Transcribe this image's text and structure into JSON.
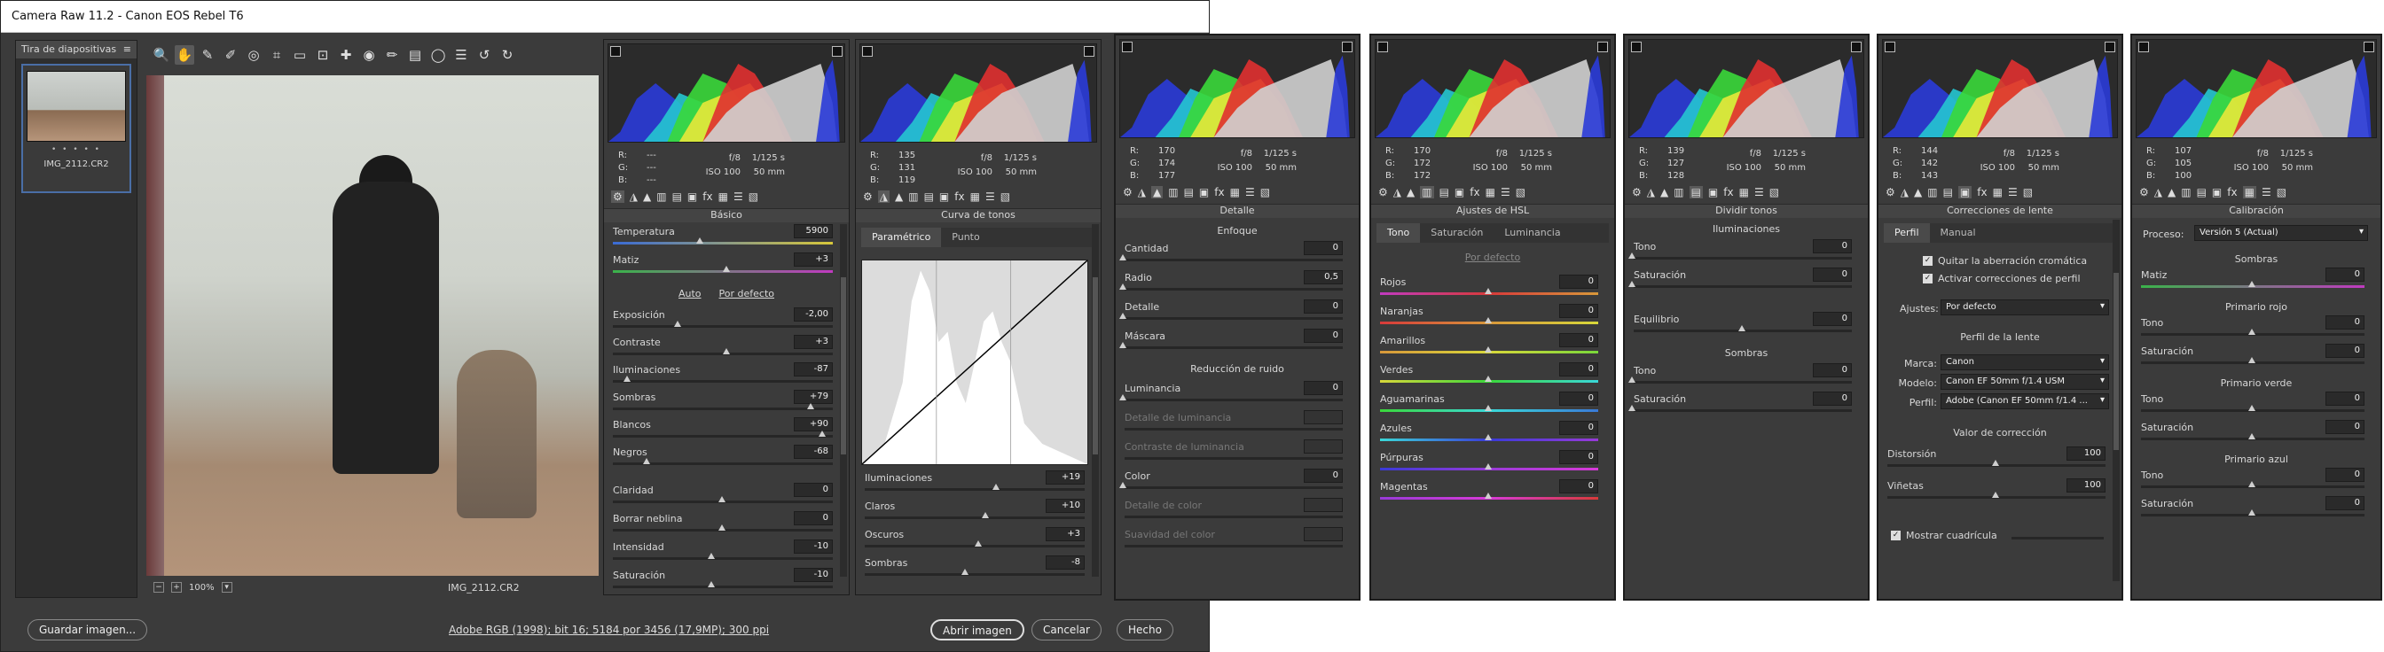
{
  "window": {
    "title": "Camera Raw 11.2 -  Canon EOS Rebel T6"
  },
  "filmstrip": {
    "title": "Tira de diapositivas",
    "file": "IMG_2112.CR2",
    "stars": "• • • • •"
  },
  "tools": [
    "zoom-icon",
    "hand-icon",
    "eyedropper-icon",
    "color-sampler-icon",
    "target-icon",
    "crop-icon",
    "straighten-icon",
    "transform-icon",
    "heal-icon",
    "redeye-icon",
    "brush-icon",
    "gradient-icon",
    "radial-icon",
    "list-icon",
    "rotate-left-icon",
    "rotate-right-icon"
  ],
  "photo": {
    "zoom": "100%",
    "filename": "IMG_2112.CR2"
  },
  "bottom": {
    "save": "Guardar imagen...",
    "info": "Adobe RGB (1998); bit 16; 5184 por 3456 (17,9MP); 300 ppi",
    "open": "Abrir imagen",
    "cancel": "Cancelar",
    "done": "Hecho"
  },
  "camera": {
    "aperture": "f/8",
    "shutter": "1/125 s",
    "iso": "ISO 100",
    "focal": "50 mm"
  },
  "panels": {
    "basic": {
      "title": "Básico",
      "rgb": [
        "---",
        "---",
        "---"
      ],
      "auto": "Auto",
      "default": "Por defecto",
      "rows": [
        {
          "label": "Temperatura",
          "value": "5900",
          "pos": 0.4
        },
        {
          "label": "Matiz",
          "value": "+3",
          "pos": 0.52
        },
        {
          "label": "Exposición",
          "value": "-2,00",
          "pos": 0.3
        },
        {
          "label": "Contraste",
          "value": "+3",
          "pos": 0.52
        },
        {
          "label": "Iluminaciones",
          "value": "-87",
          "pos": 0.07
        },
        {
          "label": "Sombras",
          "value": "+79",
          "pos": 0.9
        },
        {
          "label": "Blancos",
          "value": "+90",
          "pos": 0.95
        },
        {
          "label": "Negros",
          "value": "-68",
          "pos": 0.16
        },
        {
          "label": "Claridad",
          "value": "0",
          "pos": 0.5
        },
        {
          "label": "Borrar neblina",
          "value": "0",
          "pos": 0.5
        },
        {
          "label": "Intensidad",
          "value": "-10",
          "pos": 0.45
        },
        {
          "label": "Saturación",
          "value": "-10",
          "pos": 0.45
        }
      ]
    },
    "curve": {
      "title": "Curva de tonos",
      "rgb": [
        "135",
        "131",
        "119"
      ],
      "tabs": [
        "Paramétrico",
        "Punto"
      ],
      "rows": [
        {
          "label": "Iluminaciones",
          "value": "+19",
          "pos": 0.6
        },
        {
          "label": "Claros",
          "value": "+10",
          "pos": 0.55
        },
        {
          "label": "Oscuros",
          "value": "+3",
          "pos": 0.52
        },
        {
          "label": "Sombras",
          "value": "-8",
          "pos": 0.46
        }
      ]
    },
    "detail": {
      "title": "Detalle",
      "rgb": [
        "170",
        "174",
        "177"
      ],
      "sharpen": "Enfoque",
      "noise": "Reducción de ruido",
      "rows1": [
        {
          "label": "Cantidad",
          "value": "0",
          "pos": 0.0
        },
        {
          "label": "Radio",
          "value": "0,5",
          "pos": 0.0
        },
        {
          "label": "Detalle",
          "value": "0",
          "pos": 0.0
        },
        {
          "label": "Máscara",
          "value": "0",
          "pos": 0.0
        }
      ],
      "rows2": [
        {
          "label": "Luminancia",
          "value": "0",
          "pos": 0.0,
          "dis": false
        },
        {
          "label": "Detalle de luminancia",
          "value": "",
          "pos": 0,
          "dis": true
        },
        {
          "label": "Contraste de luminancia",
          "value": "",
          "pos": 0,
          "dis": true
        },
        {
          "label": "Color",
          "value": "0",
          "pos": 0.0,
          "dis": false
        },
        {
          "label": "Detalle de color",
          "value": "",
          "pos": 0,
          "dis": true
        },
        {
          "label": "Suavidad del color",
          "value": "",
          "pos": 0,
          "dis": true
        }
      ]
    },
    "hsl": {
      "title": "Ajustes de HSL",
      "rgb": [
        "170",
        "172",
        "172"
      ],
      "tabs": [
        "Tono",
        "Saturación",
        "Luminancia"
      ],
      "default": "Por defecto",
      "rows": [
        {
          "label": "Rojos",
          "value": "0",
          "pos": 0.5
        },
        {
          "label": "Naranjas",
          "value": "0",
          "pos": 0.5
        },
        {
          "label": "Amarillos",
          "value": "0",
          "pos": 0.5
        },
        {
          "label": "Verdes",
          "value": "0",
          "pos": 0.5
        },
        {
          "label": "Aguamarinas",
          "value": "0",
          "pos": 0.5
        },
        {
          "label": "Azules",
          "value": "0",
          "pos": 0.5
        },
        {
          "label": "Púrpuras",
          "value": "0",
          "pos": 0.5
        },
        {
          "label": "Magentas",
          "value": "0",
          "pos": 0.5
        }
      ]
    },
    "split": {
      "title": "Dividir tonos",
      "rgb": [
        "139",
        "127",
        "128"
      ],
      "hl": "Iluminaciones",
      "sh": "Sombras",
      "hlrows": [
        {
          "label": "Tono",
          "value": "0",
          "pos": 0.0
        },
        {
          "label": "Saturación",
          "value": "0",
          "pos": 0.0
        }
      ],
      "balance": {
        "label": "Equilibrio",
        "value": "0",
        "pos": 0.5
      },
      "shrows": [
        {
          "label": "Tono",
          "value": "0",
          "pos": 0.0
        },
        {
          "label": "Saturación",
          "value": "0",
          "pos": 0.0
        }
      ]
    },
    "lens": {
      "title": "Correcciones de lente",
      "rgb": [
        "144",
        "142",
        "143"
      ],
      "tabs": [
        "Perfil",
        "Manual"
      ],
      "chk1": "Quitar la aberración cromática",
      "chk2": "Activar correcciones de perfil",
      "setup_label": "Ajustes:",
      "setup": "Por defecto",
      "profile_title": "Perfil de la lente",
      "make_label": "Marca:",
      "make": "Canon",
      "model_label": "Modelo:",
      "model": "Canon EF 50mm f/1.4 USM",
      "profile_label": "Perfil:",
      "profile": "Adobe (Canon EF 50mm f/1.4 ...",
      "amount_title": "Valor de corrección",
      "rows": [
        {
          "label": "Distorsión",
          "value": "100",
          "pos": 0.5
        },
        {
          "label": "Viñetas",
          "value": "100",
          "pos": 0.5
        }
      ],
      "grid": "Mostrar cuadrícula"
    },
    "calib": {
      "title": "Calibración",
      "rgb": [
        "107",
        "105",
        "100"
      ],
      "process_label": "Proceso:",
      "process": "Versión 5 (Actual)",
      "shadows": "Sombras",
      "shrows": [
        {
          "label": "Matiz",
          "value": "0",
          "pos": 0.5
        }
      ],
      "red": "Primario rojo",
      "redrows": [
        {
          "label": "Tono",
          "value": "0",
          "pos": 0.5
        },
        {
          "label": "Saturación",
          "value": "0",
          "pos": 0.5
        }
      ],
      "green": "Primario verde",
      "greenrows": [
        {
          "label": "Tono",
          "value": "0",
          "pos": 0.5
        },
        {
          "label": "Saturación",
          "value": "0",
          "pos": 0.5
        }
      ],
      "blue": "Primario azul",
      "bluerows": [
        {
          "label": "Tono",
          "value": "0",
          "pos": 0.5
        },
        {
          "label": "Saturación",
          "value": "0",
          "pos": 0.5
        }
      ]
    }
  }
}
